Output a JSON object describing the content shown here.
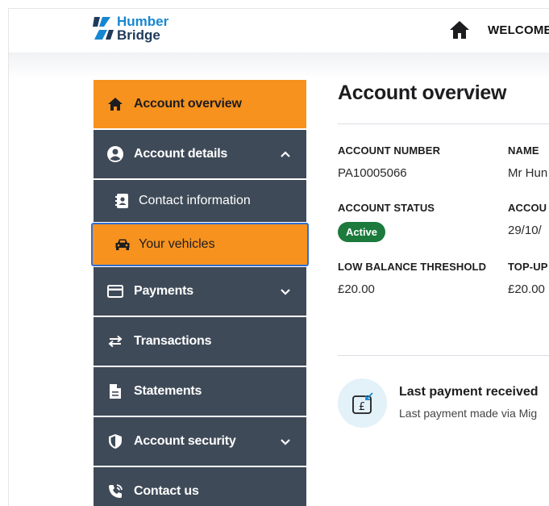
{
  "header": {
    "logo_line1": "Humber",
    "logo_line2": "Bridge",
    "welcome": "WELCOME",
    "home_icon": "home-icon"
  },
  "sidebar": {
    "items": [
      {
        "label": "Account overview",
        "icon": "home-icon",
        "active": true
      },
      {
        "label": "Account details",
        "icon": "account-circle-icon",
        "expanded": true
      },
      {
        "label": "Contact information",
        "icon": "contact-card-icon",
        "sub": true
      },
      {
        "label": "Your vehicles",
        "icon": "car-icon",
        "sub": true,
        "selected": true
      },
      {
        "label": "Payments",
        "icon": "credit-card-icon",
        "expandable": true
      },
      {
        "label": "Transactions",
        "icon": "swap-arrows-icon"
      },
      {
        "label": "Statements",
        "icon": "document-icon"
      },
      {
        "label": "Account security",
        "icon": "shield-icon",
        "expandable": true
      },
      {
        "label": "Contact us",
        "icon": "phone-icon"
      }
    ]
  },
  "main": {
    "title": "Account overview",
    "fields": {
      "account_number_label": "ACCOUNT NUMBER",
      "account_number_value": "PA10005066",
      "name_label": "NAME",
      "name_value": "Mr Hun",
      "account_status_label": "ACCOUNT STATUS",
      "account_status_value": "Active",
      "account_col2_label": "ACCOU",
      "account_col2_value": "29/10/",
      "low_balance_label": "LOW BALANCE THRESHOLD",
      "low_balance_value": "£20.00",
      "topup_label": "TOP-UP",
      "topup_value": "£20.00"
    },
    "last_payment": {
      "title": "Last payment received",
      "subtitle": "Last payment made via Mig"
    }
  },
  "colors": {
    "accent_orange": "#f7921e",
    "nav_dark": "#3f4a58",
    "active_badge": "#1b7a3c",
    "brand_blue": "#1687d2",
    "brand_navy": "#1f3a5a",
    "focus_outline": "#2f6fd6"
  }
}
